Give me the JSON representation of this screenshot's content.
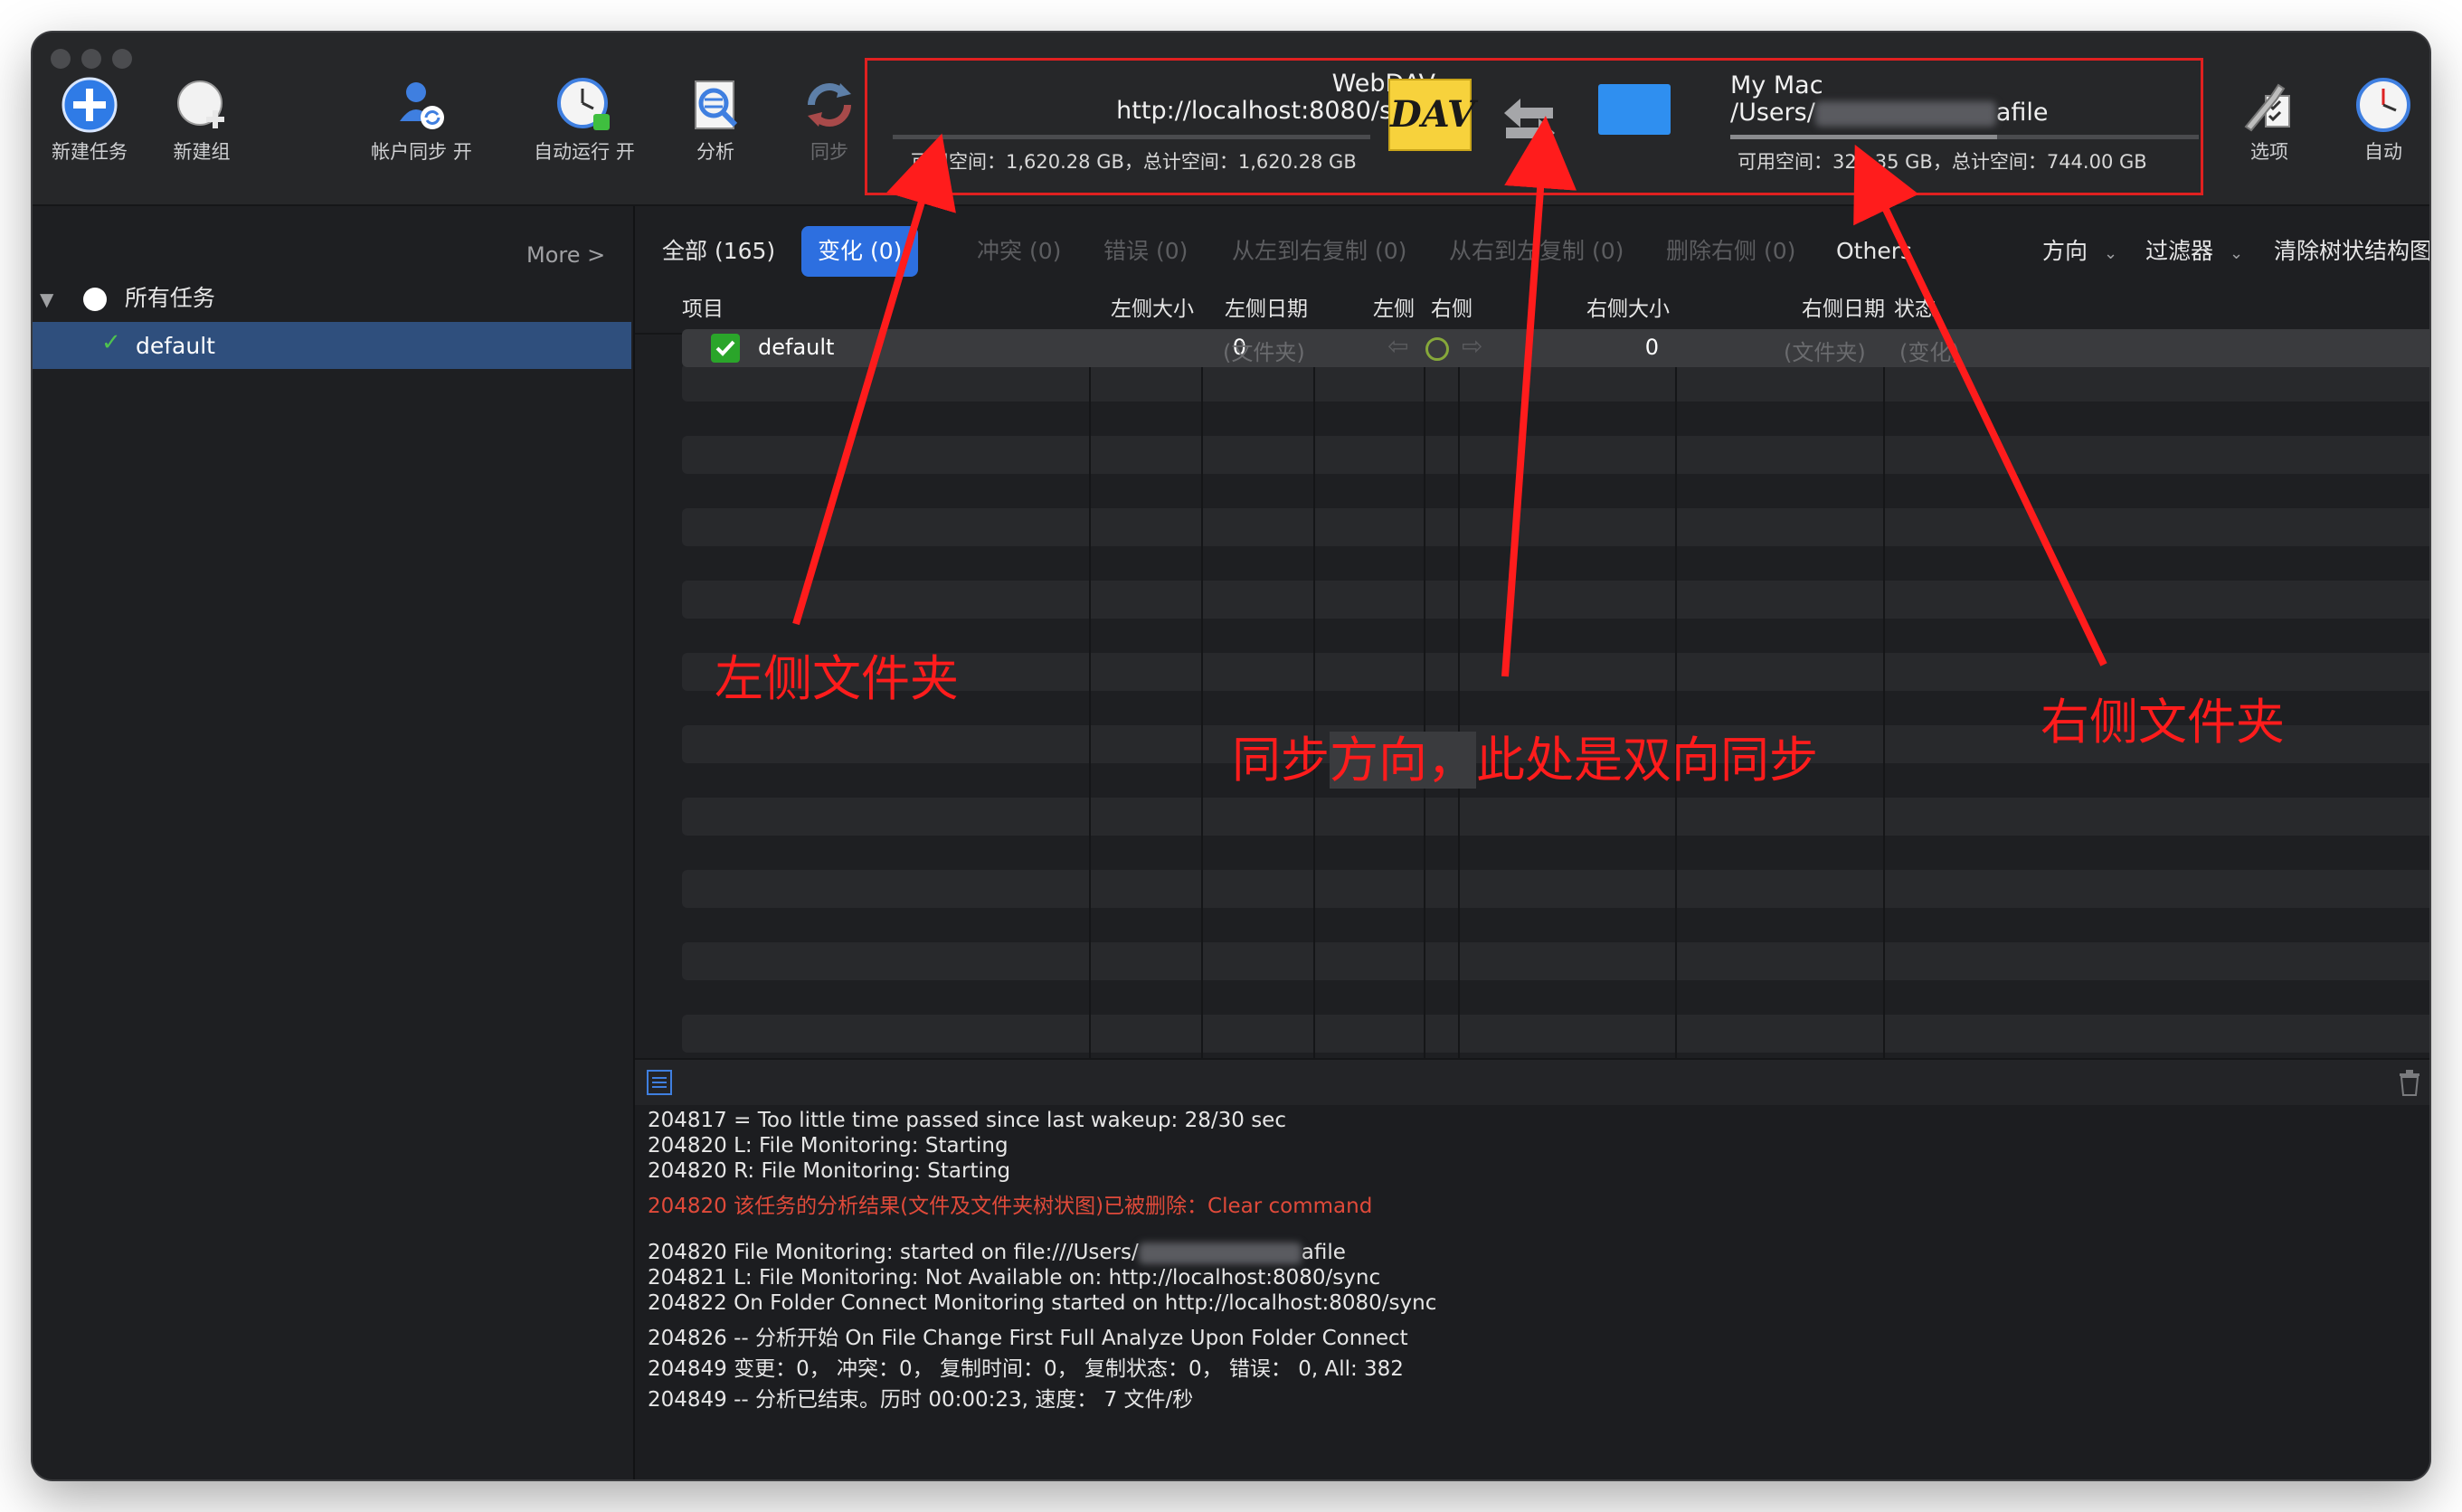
{
  "toolbar": {
    "new_task": "新建任务",
    "new_group": "新建组",
    "account_sync": "帐户同步 开",
    "auto_run": "自动运行 开",
    "analyze": "分析",
    "sync": "同步",
    "options": "选项",
    "auto": "自动"
  },
  "left_location": {
    "type": "WebDAV",
    "url": "http://localhost:8080/sync",
    "space": "可用空间：1,620.28 GB，总计空间：1,620.28 GB",
    "logo_text": "DAV",
    "usage_fraction": 0.0
  },
  "right_location": {
    "name": "My Mac",
    "path_prefix": "/Users/",
    "path_suffix": "afile",
    "space": "可用空间：320.35 GB，总计空间：744.00 GB",
    "usage_fraction": 0.57
  },
  "sidebar": {
    "more": "More >",
    "root_label": "所有任务",
    "item_label": "default"
  },
  "filters": {
    "all": "全部 (165)",
    "changed": "变化 (0)",
    "conflict": "冲突 (0)",
    "errors": "错误 (0)",
    "copy_l2r": "从左到右复制 (0)",
    "copy_r2l": "从右到左复制 (0)",
    "delete_right": "删除右侧 (0)",
    "others": "Others",
    "direction": "方向",
    "filter": "过滤器",
    "clear_tree": "清除树状结构图"
  },
  "columns": {
    "item": "项目",
    "left_size": "左侧大小",
    "left_date": "左侧日期",
    "left": "左侧",
    "right": "右侧",
    "right_size": "右侧大小",
    "right_date": "右侧日期",
    "status": "状态"
  },
  "row": {
    "name": "default",
    "left_size": "0",
    "left_date": "(文件夹)",
    "right_size": "0",
    "right_date": "(文件夹)",
    "status": "(变化)"
  },
  "log": {
    "lines": [
      "204817 = Too little time passed since last wakeup: 28/30 sec",
      "204820 L: File Monitoring: Starting",
      "204820 R: File Monitoring: Starting",
      "204820 该任务的分析结果(文件及文件夹树状图)已被删除：Clear command",
      "204820 File Monitoring: started on file:///Users/",
      "204821 L: File Monitoring: Not Available on: http://localhost:8080/sync",
      "204822 On Folder Connect Monitoring started on http://localhost:8080/sync",
      "204826 -- 分析开始 On File Change First Full Analyze Upon Folder Connect",
      "204849 变更：0，  冲突：0，  复制时间：0，  复制状态：0，  错误：  0, All: 382",
      "204849 -- 分析已结束。历时 00:00:23, 速度：  7 文件/秒"
    ],
    "line5_suffix": "afile"
  },
  "annotations": {
    "left_folder": "左侧文件夹",
    "direction_a": "同步",
    "direction_b": "方向，",
    "direction_c": "此处是双向同步",
    "right_folder": "右侧文件夹"
  },
  "colors": {
    "accent": "#2d6fe0",
    "annotation": "#ff1c1c",
    "selection": "#2f4f7d",
    "log_error": "#e04a3a",
    "check_green": "#2aa52a"
  }
}
